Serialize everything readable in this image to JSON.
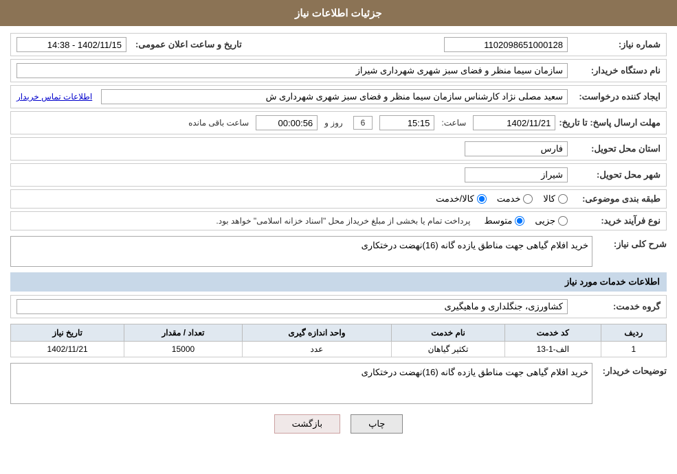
{
  "header": {
    "title": "جزئیات اطلاعات نیاز"
  },
  "form": {
    "need_number_label": "شماره نیاز:",
    "need_number_value": "1102098651000128",
    "announcement_label": "تاریخ و ساعت اعلان عمومی:",
    "announcement_value": "1402/11/15 - 14:38",
    "buyer_org_label": "نام دستگاه خریدار:",
    "buyer_org_value": "سازمان سیما منظر و فضای سبز شهری شهرداری شیراز",
    "creator_label": "ایجاد کننده درخواست:",
    "creator_name": "سعید مصلی نژاد کارشناس سازمان سیما منظر و فضای سبز شهری شهرداری ش",
    "creator_link": "اطلاعات تماس خریدار",
    "response_deadline_label": "مهلت ارسال پاسخ: تا تاریخ:",
    "response_date": "1402/11/21",
    "response_time_label": "ساعت:",
    "response_time": "15:15",
    "response_days_label": "روز و",
    "response_days": "6",
    "response_remaining_label": "ساعت باقی مانده",
    "response_remaining_time": "00:00:56",
    "province_label": "استان محل تحویل:",
    "province_value": "فارس",
    "city_label": "شهر محل تحویل:",
    "city_value": "شیراز",
    "category_label": "طبقه بندی موضوعی:",
    "category_kala": "کالا",
    "category_khadamat": "خدمت",
    "category_kala_khadamat": "کالا/خدمت",
    "purchase_type_label": "نوع فرآیند خرید:",
    "purchase_jozii": "جزیی",
    "purchase_motawaset": "متوسط",
    "purchase_note": "پرداخت تمام یا بخشی از مبلغ خریداز محل \"اسناد خزانه اسلامی\" خواهد بود.",
    "general_desc_label": "شرح کلی نیاز:",
    "general_desc_value": "خرید افلام گیاهی جهت مناطق یازده گانه (16)نهضت درختکاری",
    "services_section_title": "اطلاعات خدمات مورد نیاز",
    "service_group_label": "گروه خدمت:",
    "service_group_value": "کشاورزی، جنگلداری و ماهیگیری",
    "table": {
      "headers": [
        "ردیف",
        "کد خدمت",
        "نام خدمت",
        "واحد اندازه گیری",
        "تعداد / مقدار",
        "تاریخ نیاز"
      ],
      "rows": [
        {
          "row": "1",
          "code": "الف-1-13",
          "name": "تکثیر گیاهان",
          "unit": "عدد",
          "quantity": "15000",
          "date": "1402/11/21"
        }
      ]
    },
    "buyer_description_label": "توضیحات خریدار:",
    "buyer_description_value": "خرید افلام گیاهی جهت مناطق یازده گانه (16)نهضت درختکاری"
  },
  "buttons": {
    "print": "چاپ",
    "back": "بازگشت"
  }
}
